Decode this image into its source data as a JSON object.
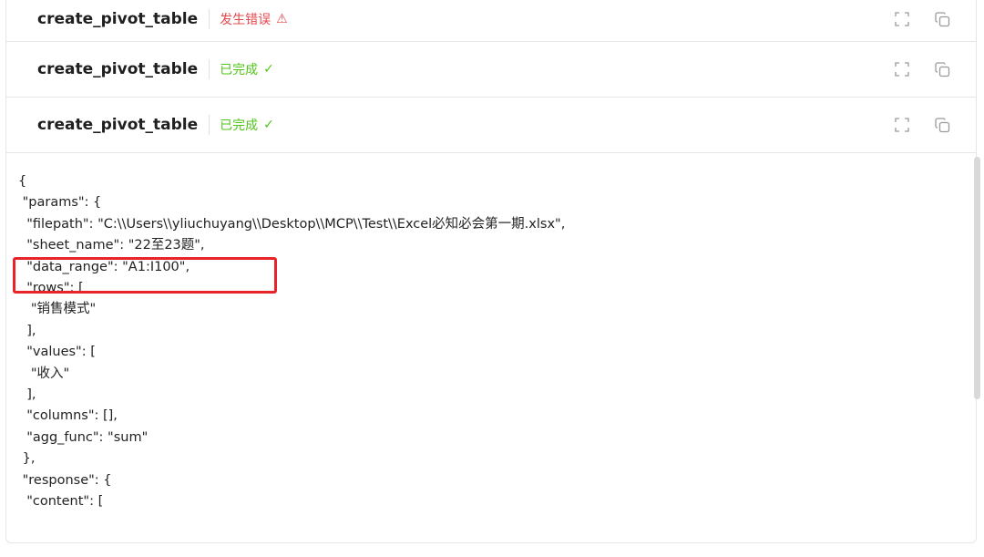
{
  "tools": [
    {
      "name": "create_pivot_table",
      "status": "发生错误",
      "status_icon": "⚠",
      "status_type": "error"
    },
    {
      "name": "create_pivot_table",
      "status": "已完成",
      "status_icon": "✓",
      "status_type": "done"
    },
    {
      "name": "create_pivot_table",
      "status": "已完成",
      "status_icon": "✓",
      "status_type": "done"
    }
  ],
  "code_lines": [
    "{",
    " \"params\": {",
    "  \"filepath\": \"C:\\\\Users\\\\yliuchuyang\\\\Desktop\\\\MCP\\\\Test\\\\Excel必知必会第一期.xlsx\",",
    "  \"sheet_name\": \"22至23题\",",
    "  \"data_range\": \"A1:I100\",",
    "  \"rows\": [",
    "   \"销售模式\"",
    "  ],",
    "  \"values\": [",
    "   \"收入\"",
    "  ],",
    "  \"columns\": [],",
    "  \"agg_func\": \"sum\"",
    " },",
    " \"response\": {",
    "  \"content\": ["
  ],
  "colors": {
    "error": "#e5484d",
    "done": "#52c41a",
    "highlight": "#e8242a"
  },
  "icons": {
    "expand": "expand-icon",
    "copy": "copy-icon"
  }
}
